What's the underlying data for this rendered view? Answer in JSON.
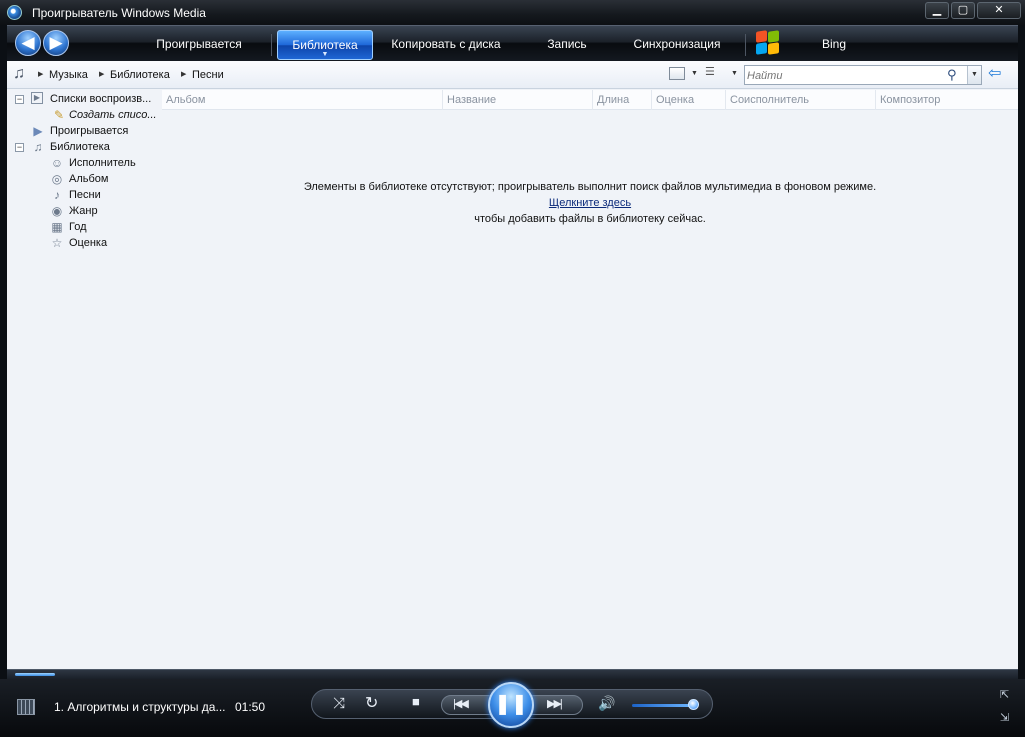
{
  "window": {
    "title": "Проигрыватель Windows Media",
    "minimize": "▁",
    "maximize": "▢",
    "close": "✕"
  },
  "nav": {
    "tabs": [
      {
        "label": "Проигрывается",
        "active": false
      },
      {
        "label": "Библиотека",
        "active": true
      },
      {
        "label": "Копировать с диска",
        "active": false
      },
      {
        "label": "Запись",
        "active": false
      },
      {
        "label": "Синхронизация",
        "active": false
      },
      {
        "label": "Bing",
        "active": false
      }
    ]
  },
  "breadcrumb": [
    "Музыка",
    "Библиотека",
    "Песни"
  ],
  "search": {
    "placeholder": "Найти",
    "value": ""
  },
  "tree": {
    "playlists": "Списки воспроизв...",
    "create_playlist": "Создать списо...",
    "now_playing": "Проигрывается",
    "library": "Библиотека",
    "items": [
      "Исполнитель",
      "Альбом",
      "Песни",
      "Жанр",
      "Год",
      "Оценка"
    ]
  },
  "columns": [
    "Альбом",
    "Название",
    "Длина",
    "Оценка",
    "Соисполнитель",
    "Композитор"
  ],
  "message": {
    "line1": "Элементы в библиотеке отсутствуют; проигрыватель выполнит поиск файлов мультимедиа в фоновом режиме.",
    "link": "Щелкните здесь",
    "line3": "чтобы добавить файлы в библиотеку сейчас."
  },
  "player": {
    "now_playing_title": "1. Алгоритмы и структуры да...",
    "time": "01:50",
    "seek_fraction": 0.04,
    "volume_fraction": 0.9
  },
  "colors": {
    "accent": "#1e67d8",
    "content_bg": "#f0f3f8",
    "chrome_dark": "#0b0f14"
  }
}
